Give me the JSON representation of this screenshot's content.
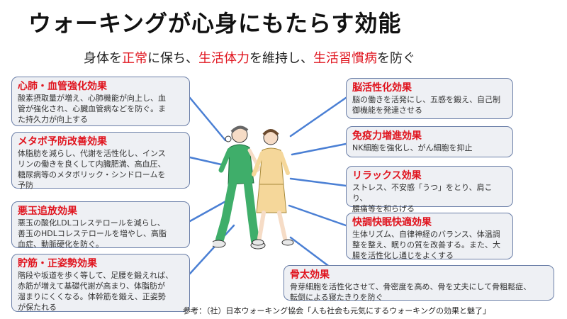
{
  "title": "ウォーキングが心身にもたらす効能",
  "subtitle": {
    "parts": [
      "身体を",
      "正常",
      "に保ち、",
      "生活体力",
      "を維持し、",
      "生活習慣病",
      "を防ぐ"
    ]
  },
  "left_cards": [
    {
      "title": "心肺・血管強化効果",
      "body": "酸素摂取量が増え、心肺機能が向上し、血\n管が強化され、心臓血管病などを防ぐ。ま\nた持久力が向上する"
    },
    {
      "title": "メタボ予防改善効果",
      "body": "体脂肪を減らし、代謝を活性化し、インス\nリンの働きを良くして内臓肥満、高血圧、\n糖尿病等のメタボリック・シンドロームを\n予防"
    },
    {
      "title": "悪玉追放効果",
      "body": "悪玉の酸化LDLコレステロールを減らし、\n善玉のHDLコレステロールを増やし、高脂\n血症、動脈硬化を防ぐ。"
    },
    {
      "title": "貯筋・正姿勢効果",
      "body": "階段や坂道を歩く等して、足腰を鍛えれば、\n赤筋が増えて基礎代謝が高まり、体脂肪が\n溜まりにくくなる。体幹筋を鍛え、正姿勢\nが保たれる"
    }
  ],
  "right_cards": [
    {
      "title": "脳活性化効果",
      "body": "脳の働きを活発にし、五感を鍛え、自己制\n御機能を発達させる"
    },
    {
      "title": "免疫力増進効果",
      "body": "NK細胞を強化し、がん細胞を抑止"
    },
    {
      "title": "リラックス効果",
      "body": "ストレス、不安感「うつ」をとり、肩こり、\n腰痛等を和らげる"
    },
    {
      "title": "快調快眠快適効果",
      "body": "生体リズム、自律神経のバランス、体温調\n整を整え、眠りの質を改善する。また、大\n腸を活性化し通じをよくする"
    }
  ],
  "bottom_card": {
    "title": "骨太効果",
    "body": "骨芽細胞を活性化させて、骨密度を高め、骨を丈夫にして骨粗鬆症、\n転倒による寝たきりを防ぐ"
  },
  "source": "参考：（社）日本ウォーキング協会「人も社会も元気にするウォーキングの効果と魅了」",
  "colors": {
    "accent": "#e0141e",
    "card_bg": "#eef0f4",
    "card_border": "#6b7fa8",
    "line": "#4a7fd4"
  }
}
